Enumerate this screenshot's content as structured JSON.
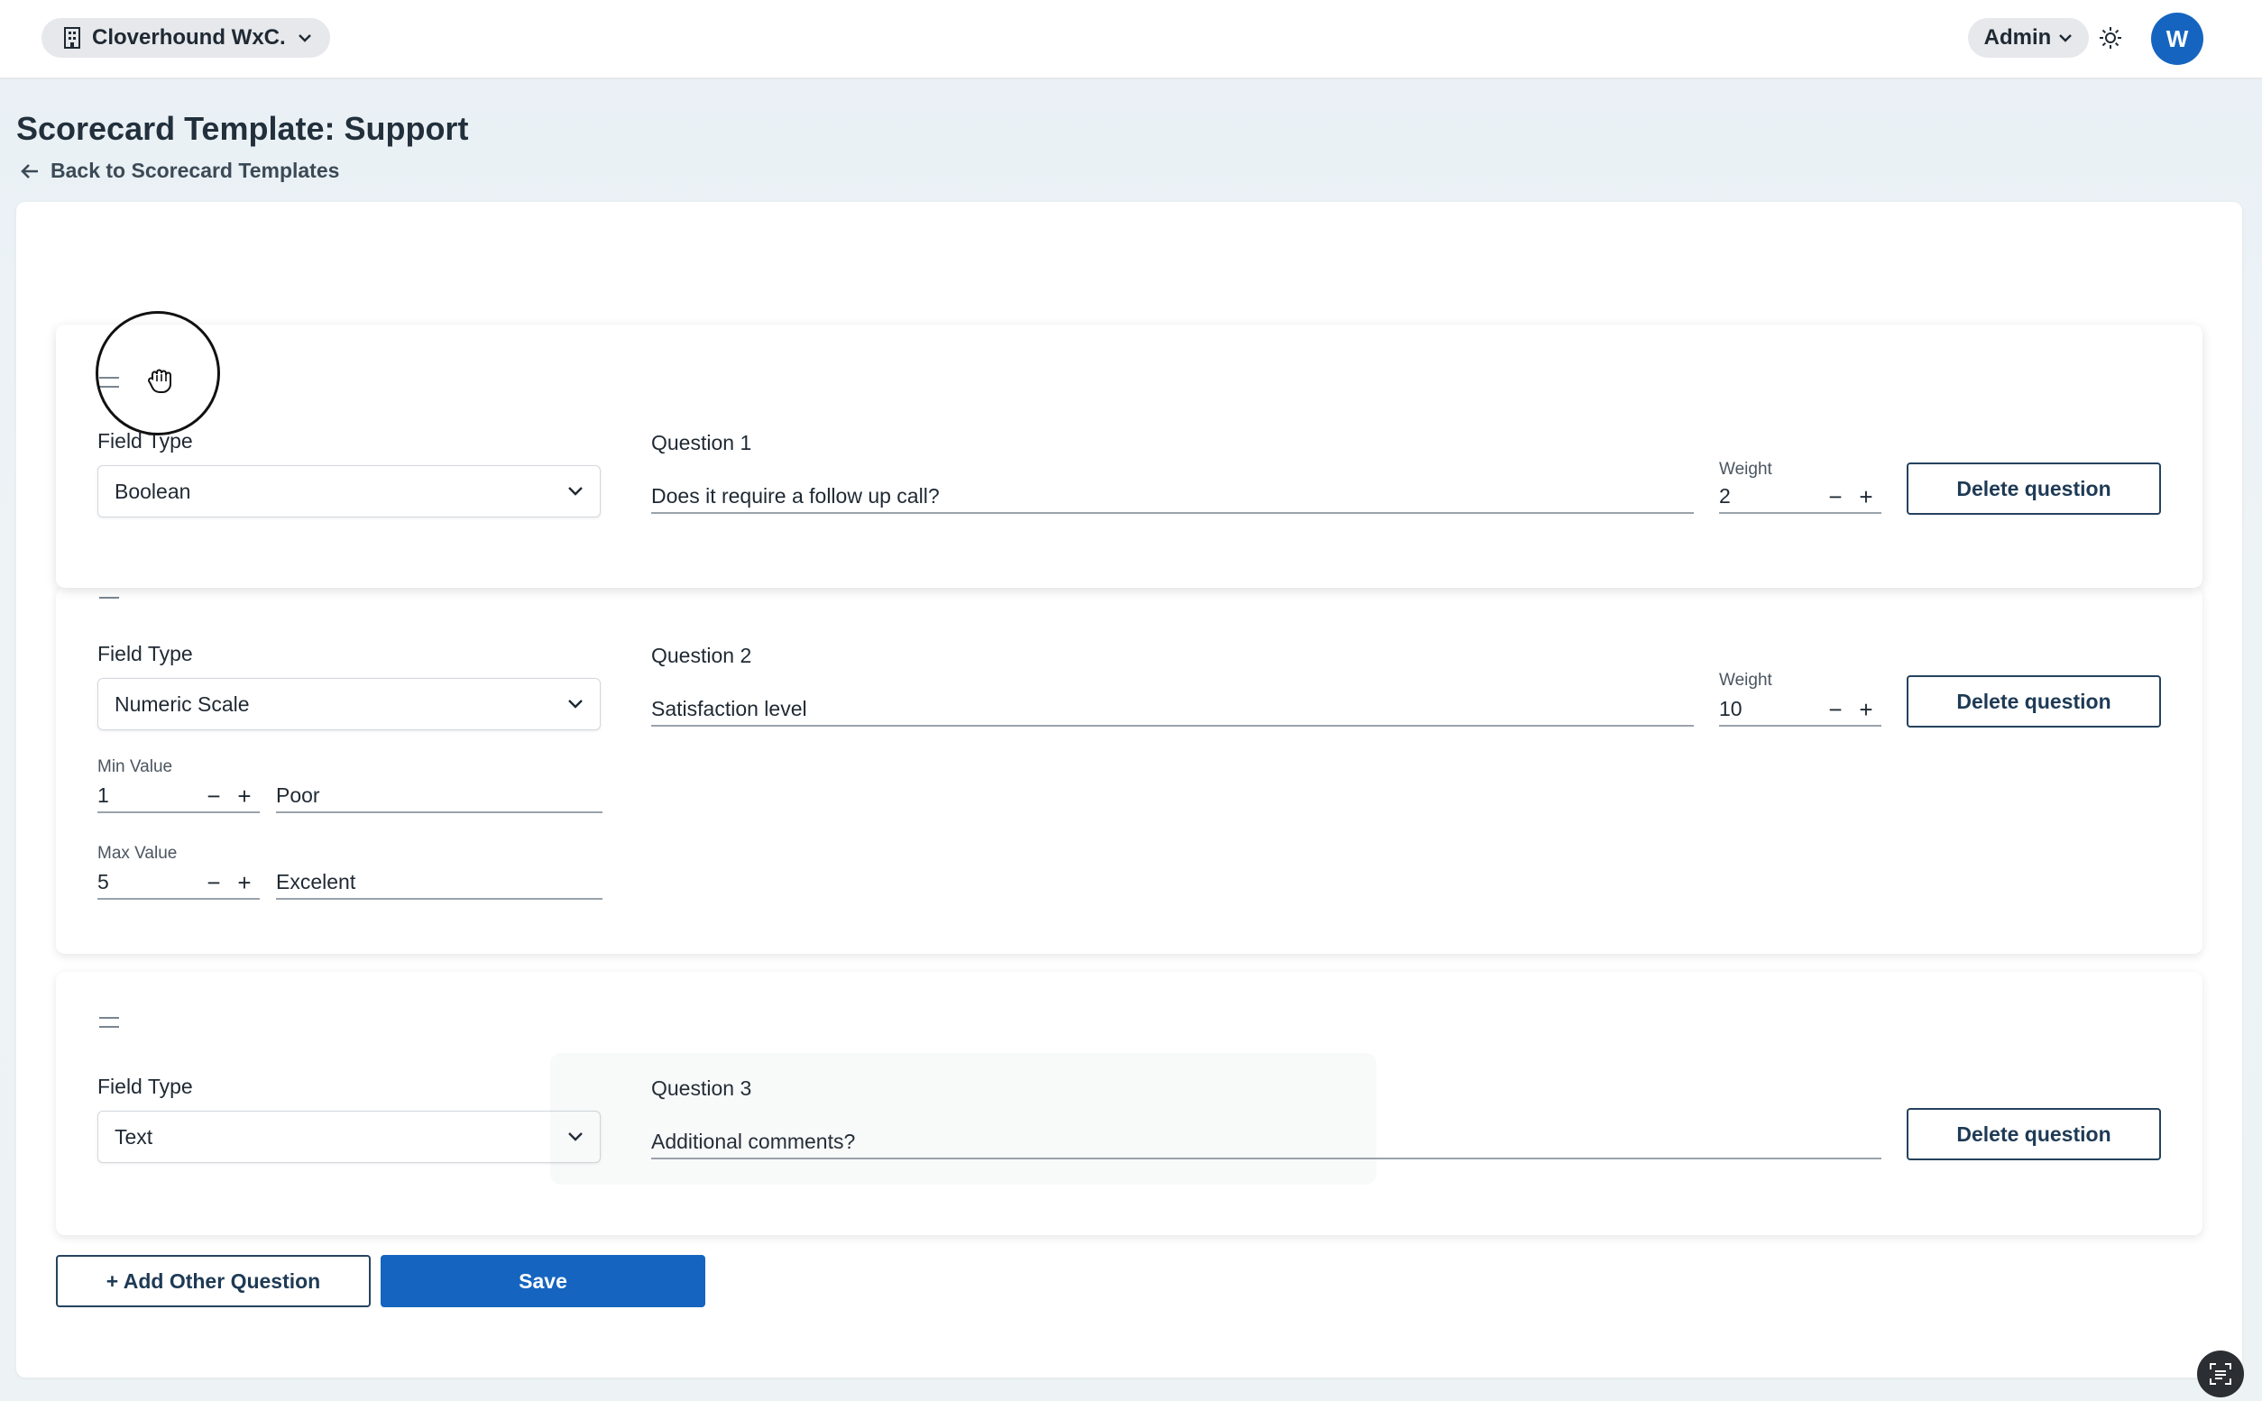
{
  "topbar": {
    "org_name": "Cloverhound WxC...",
    "role": "Admin",
    "avatar_initial": "W"
  },
  "header": {
    "title": "Scorecard Template: Support",
    "back_link": "Back to Scorecard Templates"
  },
  "labels": {
    "field_type": "Field Type",
    "weight": "Weight",
    "delete_question": "Delete question",
    "min_value": "Min Value",
    "max_value": "Max Value",
    "minus": "−",
    "plus": "+"
  },
  "questions": [
    {
      "label": "Question 1",
      "field_type": "Boolean",
      "text": "Does it require a follow up call?",
      "weight": "2"
    },
    {
      "label": "Question 2",
      "field_type": "Numeric Scale",
      "text": "Satisfaction level",
      "weight": "10",
      "min_value": "1",
      "min_label": "Poor",
      "max_value": "5",
      "max_label": "Excelent"
    },
    {
      "label": "Question 3",
      "field_type": "Text",
      "text": "Additional comments?"
    }
  ],
  "actions": {
    "add_question": "+ Add Other Question",
    "save": "Save"
  },
  "colors": {
    "primary": "#1565c0",
    "outline": "#25435e"
  }
}
